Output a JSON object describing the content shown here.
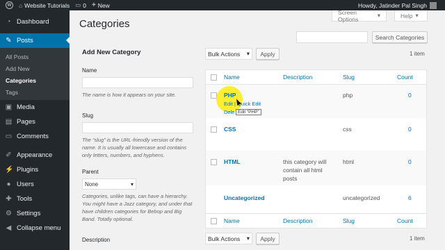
{
  "admin_bar": {
    "site_name": "Website Tutorials",
    "comments_count": "0",
    "new_label": "New",
    "howdy": "Howdy, Jatinder Pal Singh"
  },
  "sidebar": {
    "items": [
      {
        "label": "Dashboard",
        "icon": "dashboard-icon"
      },
      {
        "label": "Posts",
        "icon": "pin-icon"
      },
      {
        "label": "Media",
        "icon": "media-icon"
      },
      {
        "label": "Pages",
        "icon": "pages-icon"
      },
      {
        "label": "Comments",
        "icon": "comments-icon"
      },
      {
        "label": "Appearance",
        "icon": "appearance-icon"
      },
      {
        "label": "Plugins",
        "icon": "plugins-icon"
      },
      {
        "label": "Users",
        "icon": "users-icon"
      },
      {
        "label": "Tools",
        "icon": "tools-icon"
      },
      {
        "label": "Settings",
        "icon": "settings-icon"
      },
      {
        "label": "Collapse menu",
        "icon": "collapse-icon"
      }
    ],
    "posts_submenu": [
      "All Posts",
      "Add New",
      "Categories",
      "Tags"
    ]
  },
  "header": {
    "title": "Categories",
    "screen_options": "Screen Options",
    "help": "Help",
    "search_button": "Search Categories"
  },
  "form": {
    "heading": "Add New Category",
    "name_label": "Name",
    "name_help": "The name is how it appears on your site.",
    "slug_label": "Slug",
    "slug_help": "The “slug” is the URL-friendly version of the name. It is usually all lowercase and contains only letters, numbers, and hyphens.",
    "parent_label": "Parent",
    "parent_value": "None",
    "parent_help": "Categories, unlike tags, can have a hierarchy. You might have a Jazz category, and under that have children categories for Bebop and Big Band. Totally optional.",
    "description_label": "Description"
  },
  "table": {
    "bulk_actions": "Bulk Actions",
    "apply": "Apply",
    "items_count": "1 item",
    "columns": {
      "name": "Name",
      "description": "Description",
      "slug": "Slug",
      "count": "Count"
    },
    "rows": [
      {
        "name": "PHP",
        "description": "",
        "slug": "php",
        "count": "0"
      },
      {
        "name": "CSS",
        "description": "",
        "slug": "css",
        "count": "0"
      },
      {
        "name": "HTML",
        "description": "this category will contain all html posts",
        "slug": "html",
        "count": "0"
      },
      {
        "name": "Uncategorized",
        "description": "",
        "slug": "uncategorized",
        "count": "6"
      }
    ],
    "row_actions": {
      "edit": "Edit",
      "quick_edit": "Quick Edit",
      "delete": "Dele"
    },
    "tooltip": "Edit “PHP”"
  },
  "colors": {
    "accent": "#0073aa",
    "sidebar": "#23282d",
    "highlight": "#ffeb00"
  }
}
